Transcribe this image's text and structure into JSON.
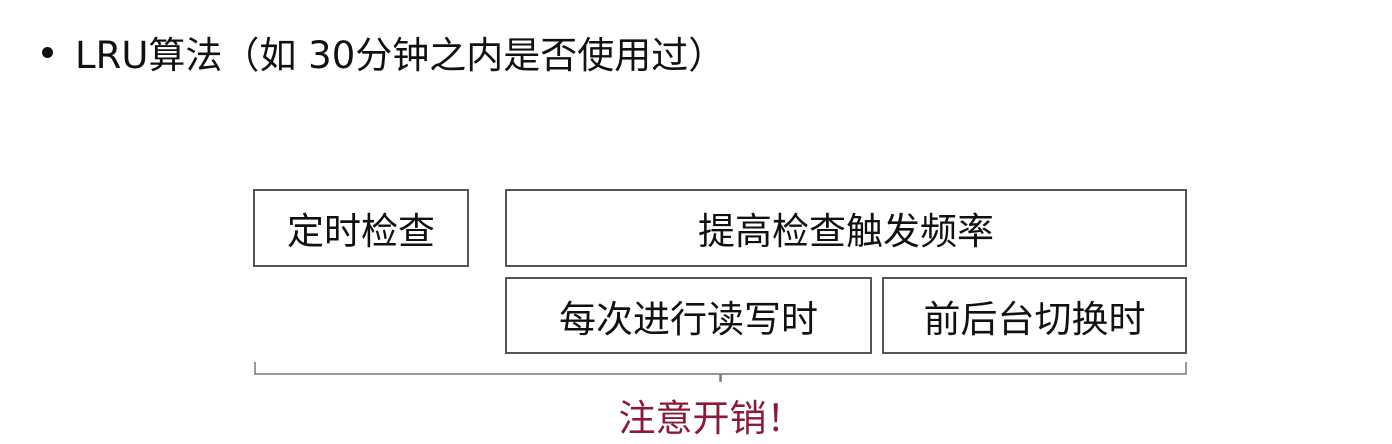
{
  "bullet": {
    "text": "LRU算法（如 30分钟之内是否使用过）"
  },
  "boxes": {
    "timer_check": "定时检查",
    "raise_frequency": "提高检查触发频率",
    "on_read_write": "每次进行读写时",
    "on_fg_bg_switch": "前后台切换时"
  },
  "note": {
    "text": "注意开销！",
    "color": "#8b1a3a"
  }
}
